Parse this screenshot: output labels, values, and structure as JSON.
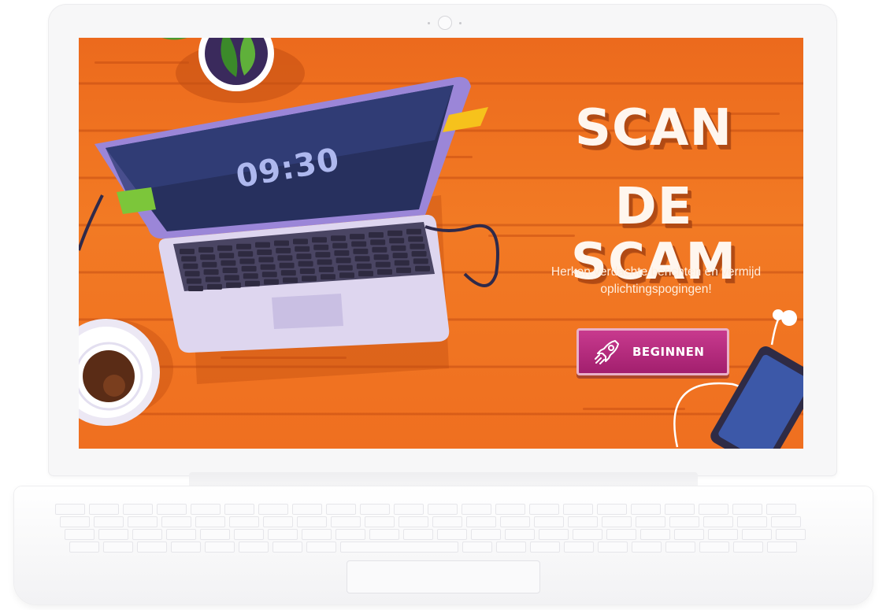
{
  "screen": {
    "title_line_1": "SCAN",
    "title_line_2": "DE SCAM",
    "subtitle": "Herken verdachte berichten en vermijd oplichtingspogingen!",
    "start_button_label": "BEGINNEN",
    "laptop_clock": "09:30"
  },
  "icons": {
    "start_button_icon": "rocket-icon"
  },
  "colors": {
    "background": "#ee6d20",
    "button": "#b52a7e",
    "title": "#fff6ee"
  }
}
